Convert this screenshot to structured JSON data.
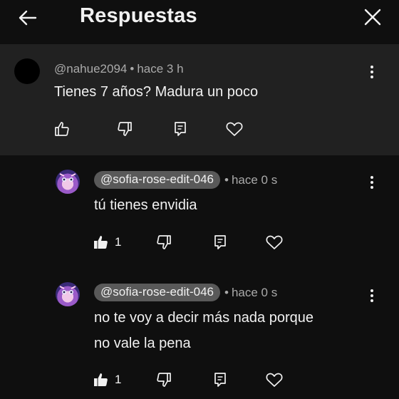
{
  "header": {
    "title": "Respuestas",
    "back_icon": "arrow-left-icon",
    "close_icon": "close-icon"
  },
  "parent_comment": {
    "author": "@nahue2094",
    "separator": "•",
    "time": "hace 3 h",
    "text": "Tienes 7 años? Madura un poco"
  },
  "replies": [
    {
      "author": "@sofia-rose-edit-046",
      "separator": "•",
      "time": "hace 0 s",
      "text_lines": [
        "tú tienes envidia"
      ],
      "likes": "1"
    },
    {
      "author": "@sofia-rose-edit-046",
      "separator": "•",
      "time": "hace 0 s",
      "text_lines": [
        "no te voy a decir más nada porque",
        "no vale la pena"
      ],
      "likes": "1"
    }
  ],
  "colors": {
    "background": "#0f0f0f",
    "highlight": "#212121",
    "text": "#f1f1f1",
    "muted": "#aaaaaa",
    "pill": "#595959"
  }
}
